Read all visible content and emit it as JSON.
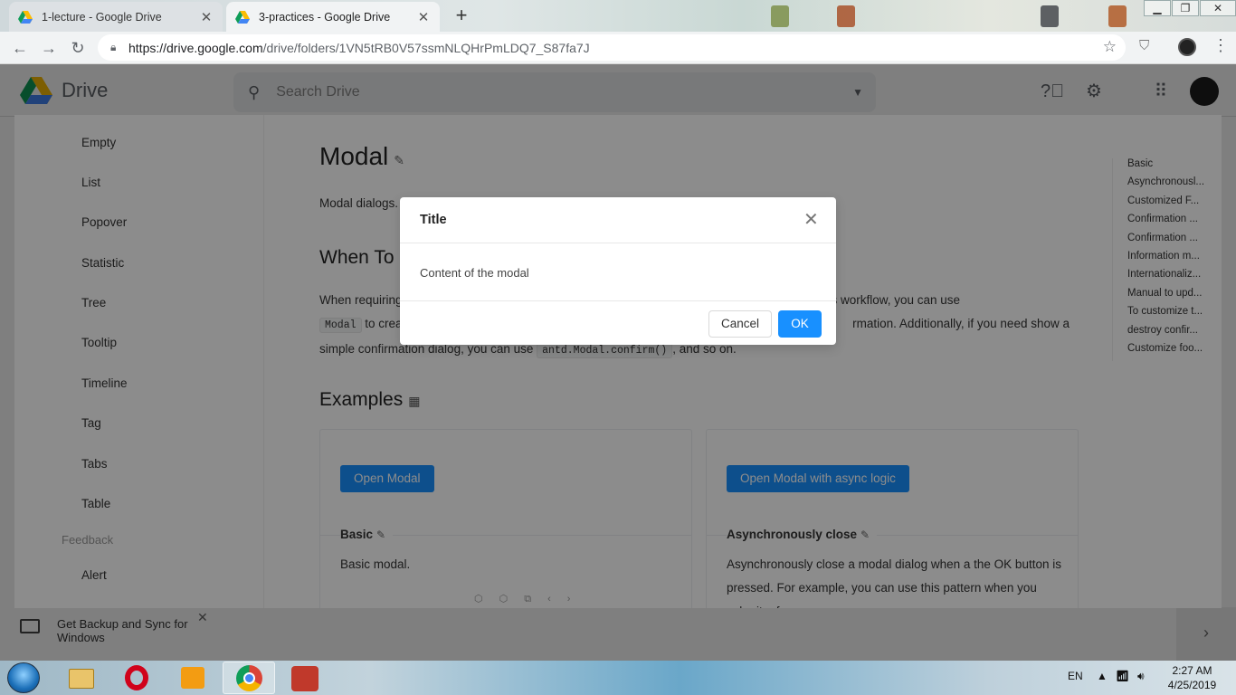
{
  "browser": {
    "tabs": [
      {
        "title": "1-lecture - Google Drive",
        "active": false
      },
      {
        "title": "3-practices - Google Drive",
        "active": true
      }
    ],
    "url_host": "https://drive.google.com",
    "url_path": "/drive/folders/1VN5tRB0V57ssmNLQHrPmLDQ7_S87fa7J"
  },
  "drive": {
    "app_name": "Drive",
    "search_placeholder": "Search Drive",
    "backup_prompt": "Get Backup and Sync for Windows"
  },
  "sidebar": {
    "items": [
      {
        "label": "Empty"
      },
      {
        "label": "List"
      },
      {
        "label": "Popover"
      },
      {
        "label": "Statistic"
      },
      {
        "label": "Tree"
      },
      {
        "label": "Tooltip"
      },
      {
        "label": "Timeline"
      },
      {
        "label": "Tag"
      },
      {
        "label": "Tabs"
      },
      {
        "label": "Table"
      }
    ],
    "group_label": "Feedback",
    "group_items": [
      {
        "label": "Alert"
      }
    ]
  },
  "doc": {
    "title": "Modal",
    "intro": "Modal dialogs.",
    "when_heading": "When To",
    "para_a": "When requiring",
    "para_b": "errupting the user's workflow, you can use",
    "code_modal": "Modal",
    "para_c": "to crea",
    "para_d": "rmation. Additionally, if you need show a",
    "para_e": "simple confirmation dialog, you can use",
    "code_confirm": "antd.Modal.confirm()",
    "para_f": ", and so on.",
    "examples_heading": "Examples"
  },
  "examples": [
    {
      "button": "Open Modal",
      "title": "Basic",
      "desc": "Basic modal."
    },
    {
      "button": "Open Modal with async logic",
      "title": "Asynchronously close",
      "desc": "Asynchronously close a modal dialog when a the OK button is pressed. For example, you can use this pattern when you submit a form."
    }
  ],
  "anchor_nav": [
    "Basic",
    "Asynchronousl...",
    "Customized F...",
    "Confirmation ...",
    "Confirmation ...",
    "Information m...",
    "Internationaliz...",
    "Manual to upd...",
    "To customize t...",
    "destroy confir...",
    "Customize foo..."
  ],
  "modal": {
    "title": "Title",
    "content": "Content of the modal",
    "cancel_label": "Cancel",
    "ok_label": "OK"
  },
  "taskbar": {
    "language": "EN",
    "time": "2:27 AM",
    "date": "4/25/2019"
  },
  "colors": {
    "primary": "#1890ff",
    "overlay": "rgba(0,0,0,0.5)"
  }
}
